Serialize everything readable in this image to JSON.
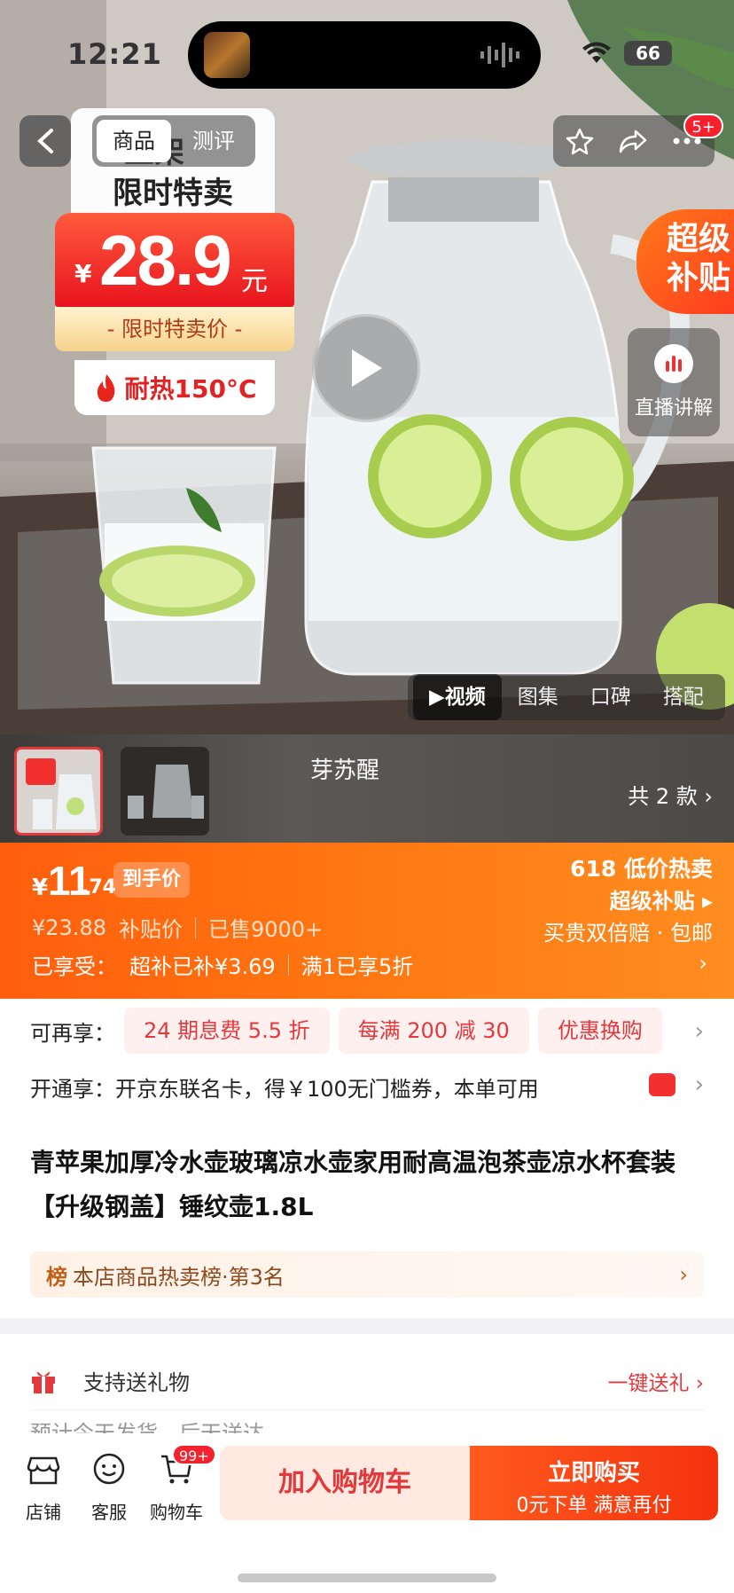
{
  "status": {
    "time": "12:21",
    "battery": "66"
  },
  "nav": {
    "tabs": [
      "商品",
      "测评"
    ],
    "notif_badge": "5+"
  },
  "promo": {
    "line1": "上架",
    "line2": "限时特卖",
    "yen": "¥",
    "price": "28.9",
    "yuan": "元",
    "label": "- 限时特卖价 -",
    "heat": "耐热150°C"
  },
  "super_subsidy": {
    "line1": "超级",
    "line2": "补贴"
  },
  "live": {
    "label": "直播讲解"
  },
  "media_tabs": [
    "▶视频",
    "图集",
    "口碑",
    "搭配"
  ],
  "variant": {
    "name": "芽苏醒",
    "count": "共 2 款"
  },
  "price_banner": {
    "yen": "¥",
    "int": "11",
    "dec": ".74",
    "tag": "到手价",
    "orig": "¥23.88",
    "orig_label": "补贴价",
    "sold": "已售9000+",
    "enjoyed": "已享受：",
    "enjoy1": "超补已补¥3.69",
    "enjoy2": "满1已享5折",
    "right1": "618 低价热卖",
    "right2": "超级补贴 ▸",
    "right3": "买贵双倍赔 · 包邮"
  },
  "benefits": {
    "label": "可再享：",
    "chips": [
      "24 期息费 5.5 折",
      "每满 200 减 30",
      "优惠换购"
    ],
    "open": "开通享：开京东联名卡，得￥100无门槛券，本单可用"
  },
  "product": {
    "title": "青苹果加厚冷水壶玻璃凉水壶家用耐高温泡茶壶凉水杯套装 【升级钢盖】锤纹壶1.8L",
    "rank_icon": "榜",
    "rank": "本店商品热卖榜·第3名"
  },
  "gift": {
    "label": "支持送礼物",
    "action": "一键送礼 ›",
    "ship": "预计今天发货，后天送达"
  },
  "bottom": {
    "shop": "店铺",
    "service": "客服",
    "cart": "购物车",
    "cart_badge": "99+",
    "add_cart": "加入购物车",
    "buy_now": "立即购买",
    "buy_sub": "0元下单 满意再付"
  },
  "colors": {
    "accent": "#e4393c",
    "orange": "#ff6a12"
  }
}
